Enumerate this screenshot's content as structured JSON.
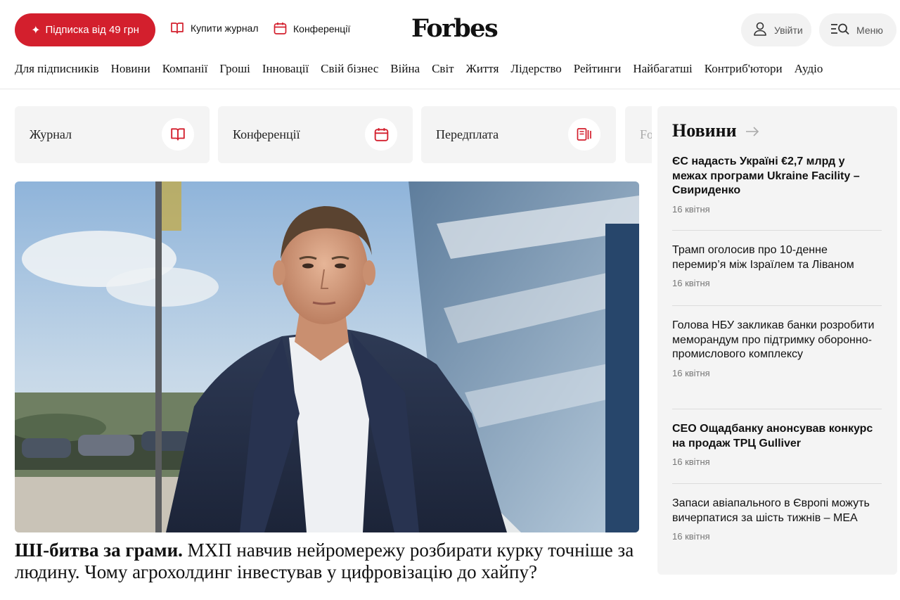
{
  "header": {
    "subscribe_label": "Підписка від 49 грн",
    "buy_magazine_label": "Купити журнал",
    "conferences_label": "Конференції",
    "logo_text": "Forbes",
    "login_label": "Увійти",
    "menu_label": "Меню"
  },
  "nav": {
    "items": [
      "Для підписників",
      "Новини",
      "Компанії",
      "Гроші",
      "Інновації",
      "Свій бізнес",
      "Війна",
      "Світ",
      "Життя",
      "Лідерство",
      "Рейтинги",
      "Найбагатші",
      "Контриб'ютори",
      "Аудіо"
    ]
  },
  "quick_cards": {
    "magazine": "Журнал",
    "conferences": "Конференції",
    "subscription": "Передплата",
    "partial": "Fo"
  },
  "hero": {
    "headline_bold": "ШІ-битва за грами.",
    "headline_rest": " МХП навчив нейромережу розбирати курку точніше за людину. Чому агрохолдинг інвестував у цифровізацію до хайпу?"
  },
  "sidebar": {
    "title": "Новини",
    "items": [
      {
        "title": "ЄС надасть Україні €2,7 млрд у межах програми Ukraine Facility – Свириденко",
        "date": "16 квітня"
      },
      {
        "title": "Трамп оголосив про 10-денне перемир’я між Ізраїлем та Ліваном",
        "date": "16 квітня"
      },
      {
        "title": "Голова НБУ закликав банки розробити меморандум про підтримку оборонно-промислового комплексу",
        "date": "16 квітня"
      },
      {
        "title": "CEO Ощадбанку анонсував конкурс на продаж ТРЦ Gulliver",
        "date": "16 квітня"
      },
      {
        "title": "Запаси авіапального в Європі можуть вичерпатися за шість тижнів – МЕА",
        "date": "16 квітня"
      }
    ]
  },
  "colors": {
    "brand_red": "#d31f2d",
    "card_bg": "#f4f4f4"
  }
}
